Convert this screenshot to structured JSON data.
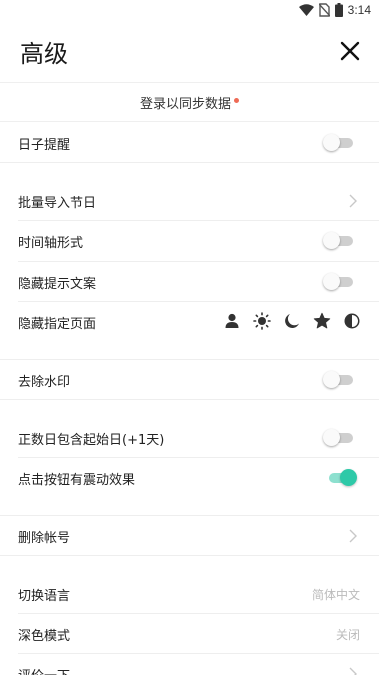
{
  "status_bar": {
    "time": "3:14",
    "icons": [
      "wifi-icon",
      "no-sim-icon",
      "battery-icon"
    ]
  },
  "header": {
    "title": "高级",
    "close_icon": "close-icon"
  },
  "login": {
    "text": "登录以同步数据"
  },
  "settings": {
    "day_reminder": {
      "label": "日子提醒",
      "enabled": false
    },
    "batch_import": {
      "label": "批量导入节日"
    },
    "timeline_mode": {
      "label": "时间轴形式",
      "enabled": false
    },
    "hide_hint_text": {
      "label": "隐藏提示文案",
      "enabled": false
    },
    "hide_pages": {
      "label": "隐藏指定页面",
      "page_icons": [
        "person-icon",
        "sun-icon",
        "moon-icon",
        "star-icon",
        "contrast-icon"
      ]
    },
    "remove_watermark": {
      "label": "去除水印",
      "enabled": false
    },
    "count_include_start": {
      "label": "正数日包含起始日(+1天)",
      "enabled": false
    },
    "click_vibration": {
      "label": "点击按钮有震动效果",
      "enabled": true
    },
    "delete_account": {
      "label": "删除帐号"
    },
    "language": {
      "label": "切换语言",
      "value": "简体中文"
    },
    "dark_mode": {
      "label": "深色模式",
      "value": "关闭"
    },
    "rate": {
      "label": "评价一下"
    }
  },
  "colors": {
    "accent": "#2ec9a8",
    "dot": "#ee6a55",
    "toggle_off": "#cfcfcf"
  }
}
